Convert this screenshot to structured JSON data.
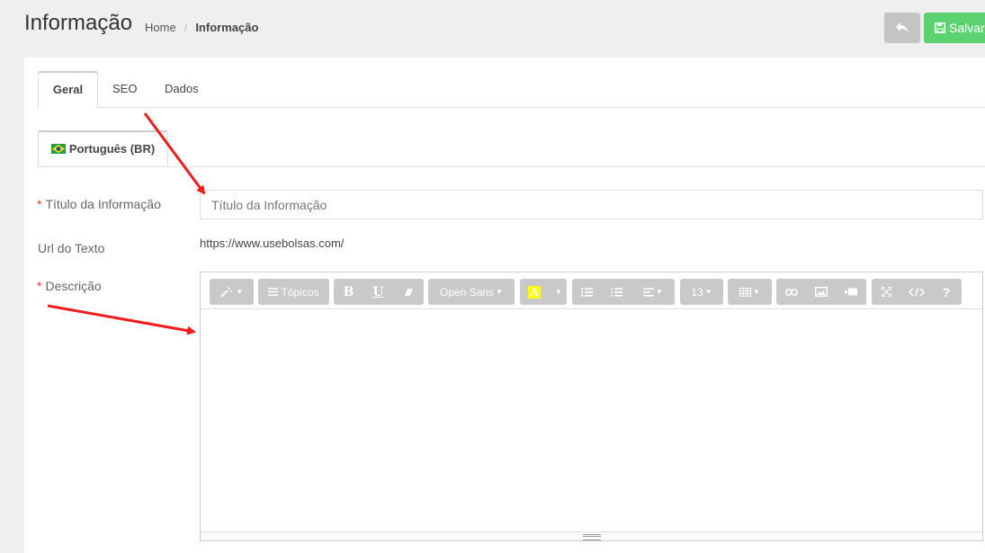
{
  "header": {
    "title": "Informação",
    "breadcrumb": {
      "home": "Home",
      "separator": "/",
      "current": "Informação"
    },
    "save_label": "Salvar",
    "back_icon": "reply-icon",
    "save_icon": "floppy-icon",
    "save_color": "#5cd370",
    "back_color": "#c4c4c4"
  },
  "tabs": [
    "Geral",
    "SEO",
    "Dados"
  ],
  "active_tab": "Geral",
  "language_tab": {
    "label": "Português (BR)",
    "icon": "brazil-flag-icon"
  },
  "form": {
    "title_label": "Título da Informação",
    "title_placeholder": "Título da Informação",
    "title_value": "",
    "url_label": "Url do Texto",
    "url_value": "https://www.usebolsas.com/",
    "description_label": "Descrição",
    "required_marker": "*"
  },
  "editor": {
    "style_button": "magic-icon",
    "topics_label": "Tópicos",
    "bold_label": "B",
    "underline_label": "U",
    "font_family": "Open Sans",
    "highlight_label": "A",
    "highlight_color": "#ffff00",
    "font_size": "13",
    "content": ""
  }
}
